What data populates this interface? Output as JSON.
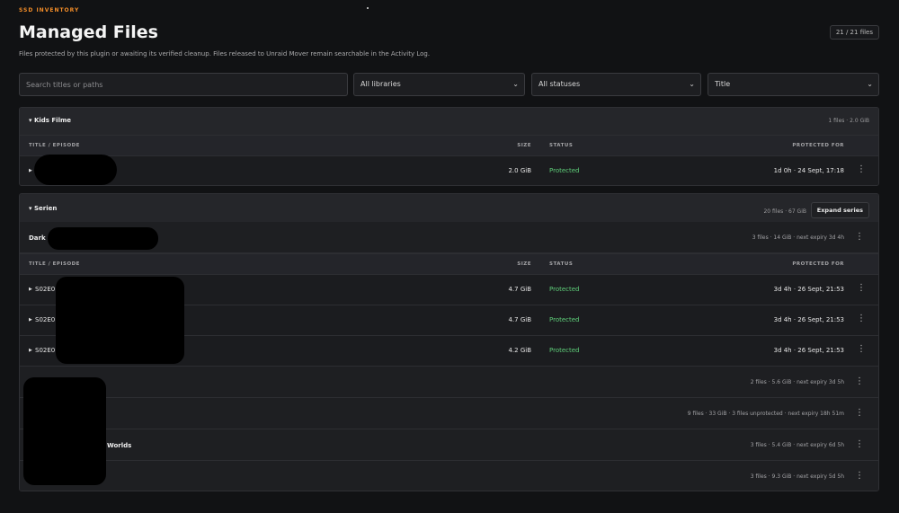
{
  "header": {
    "eyebrow": "SSD INVENTORY",
    "title": "Managed Files",
    "count": "21 / 21 files",
    "subtitle": "Files protected by this plugin or awaiting its verified cleanup. Files released to Unraid Mover remain searchable in the Activity Log."
  },
  "filters": {
    "search_placeholder": "Search titles or paths",
    "library": "All libraries",
    "status": "All statuses",
    "sort": "Title"
  },
  "columns": {
    "title": "TITLE / EPISODE",
    "size": "SIZE",
    "status": "STATUS",
    "protected": "PROTECTED FOR"
  },
  "icons": {
    "expand": "caret-right-icon",
    "collapse": "caret-down-icon",
    "select": "chevron-down-icon",
    "menu": "kebab-menu-icon"
  },
  "colors": {
    "accent": "#f28c28",
    "status_protected": "#5fcf7a"
  },
  "groups": [
    {
      "name": "Kids Filme",
      "meta": "1 files · 2.0 GiB",
      "rows": [
        {
          "name": "",
          "size": "2.0 GiB",
          "status": "Protected",
          "protected_for": "1d 0h · 24 Sept, 17:18"
        }
      ]
    },
    {
      "name": "Serien",
      "meta": "20 files · 67 GiB",
      "expand_label": "Expand series",
      "series": [
        {
          "name": "Dark",
          "meta": "3 files · 14 GiB · next expiry 3d 4h",
          "episodes": [
            {
              "name": "S02E0",
              "size": "4.7 GiB",
              "status": "Protected",
              "protected_for": "3d 4h · 26 Sept, 21:53"
            },
            {
              "name": "S02E0",
              "size": "4.7 GiB",
              "status": "Protected",
              "protected_for": "3d 4h · 26 Sept, 21:53"
            },
            {
              "name": "S02E0",
              "size": "4.2 GiB",
              "status": "Protected",
              "protected_for": "3d 4h · 26 Sept, 21:53"
            }
          ]
        },
        {
          "name": "",
          "meta": "2 files · 5.6 GiB · next expiry 3d 5h"
        },
        {
          "name": "",
          "meta": "9 files · 33 GiB · 3 files unprotected · next expiry 18h 51m"
        },
        {
          "name": "Worlds",
          "meta": "3 files · 5.4 GiB · next expiry 6d 5h"
        },
        {
          "name": "",
          "meta": "3 files · 9.3 GiB · next expiry 5d 5h"
        }
      ]
    }
  ]
}
